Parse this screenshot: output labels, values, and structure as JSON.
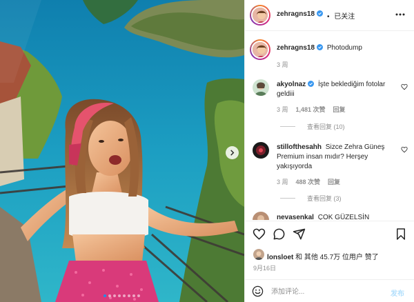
{
  "post": {
    "author": "zehragns18",
    "follow_label": "已关注",
    "follow_dot": "•",
    "more_icon": "more-horizontal-icon"
  },
  "caption": {
    "author": "zehragns18",
    "text": "Photodump",
    "time": "3 周"
  },
  "comments": [
    {
      "author": "akyolnaz",
      "verified": true,
      "text": "İşte beklediğim fotolar geldiii",
      "time": "3 周",
      "likes": "1,481 次赞",
      "reply_label": "回复",
      "view_replies": "查看回复 (10)"
    },
    {
      "author": "stillofthesahh",
      "verified": false,
      "text": "Sizce Zehra Güneş Premium insan mıdır? Herşey yakışıyorda",
      "time": "3 周",
      "likes": "488 次赞",
      "reply_label": "回复",
      "view_replies": "查看回复 (3)"
    },
    {
      "author": "nevasenkal",
      "verified": false,
      "text": "ÇOK GÜZELSİN",
      "time": "",
      "likes": "",
      "reply_label": "",
      "view_replies": ""
    }
  ],
  "actions": {
    "like": "heart-icon",
    "comment": "comment-icon",
    "share": "share-icon",
    "save": "bookmark-icon"
  },
  "likes": {
    "user": "lonsloet",
    "text": "和 其他 45.7万 位用户 赞了"
  },
  "date": "9月16日",
  "comment_box": {
    "placeholder": "添加评论...",
    "post_label": "发布"
  },
  "carousel": {
    "count": 8,
    "active_index": 0
  },
  "colors": {
    "accent": "#0095f6",
    "verified": "#3897f0",
    "text": "#262626",
    "muted": "#8e8e8e",
    "post_disabled": "#b2dffc"
  }
}
